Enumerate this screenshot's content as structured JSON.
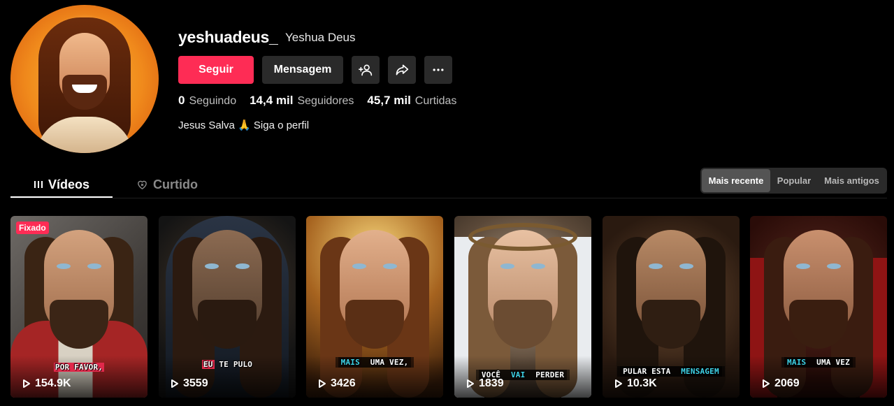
{
  "profile": {
    "username": "yeshuadeus_",
    "display_name": "Yeshua Deus",
    "bio": "Jesus Salva 🙏 Siga o perfil"
  },
  "actions": {
    "follow_label": "Seguir",
    "message_label": "Mensagem",
    "add_friend_icon": "person-plus-icon",
    "share_icon": "share-arrow-icon",
    "more_icon": "more-horizontal-icon"
  },
  "stats": [
    {
      "value": "0",
      "label": "Seguindo"
    },
    {
      "value": "14,4 mil",
      "label": "Seguidores"
    },
    {
      "value": "45,7 mil",
      "label": "Curtidas"
    }
  ],
  "tabs": [
    {
      "label": "Vídeos",
      "icon": "grid-lines-icon",
      "active": true
    },
    {
      "label": "Curtido",
      "icon": "heart-outline-icon",
      "active": false
    }
  ],
  "sort_options": [
    {
      "label": "Mais recente",
      "active": true
    },
    {
      "label": "Popular",
      "active": false
    },
    {
      "label": "Mais antigos",
      "active": false
    }
  ],
  "videos": [
    {
      "pinned_label": "Fixado",
      "caption": "POR FAVOR,",
      "plays": "154.9K"
    },
    {
      "caption_a": "EU",
      "caption_b": " TE PULO",
      "plays": "3559"
    },
    {
      "caption_a": "MAIS",
      "caption_b": " UMA VEZ,",
      "plays": "3426"
    },
    {
      "caption_a": "VOCÊ ",
      "caption_b": "VAI",
      "caption_c": " PERDER",
      "plays": "1839"
    },
    {
      "caption_a": "PULAR ESTA ",
      "caption_b": "MENSAGEM",
      "plays": "10.3K"
    },
    {
      "caption_a": "MAIS",
      "caption_b": " UMA VEZ",
      "plays": "2069"
    }
  ],
  "colors": {
    "accent": "#fe2c55",
    "button_dark": "#2a2a2a",
    "caption_highlight": "#3fd3e8"
  }
}
